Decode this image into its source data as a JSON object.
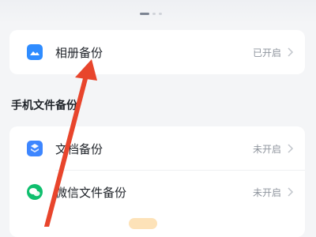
{
  "header": {
    "top_text": "",
    "page_indicator": {
      "count": 3,
      "active_index": 0
    }
  },
  "album_backup": {
    "icon": "album-icon",
    "label": "相册备份",
    "status": "已开启"
  },
  "phone_files_section": {
    "title": "手机文件备份",
    "items": [
      {
        "icon": "document-icon",
        "label": "文档备份",
        "status": "未开启"
      },
      {
        "icon": "wechat-icon",
        "label": "微信文件备份",
        "status": "未开启"
      }
    ]
  },
  "colors": {
    "background": "#f4f5f7",
    "card": "#ffffff",
    "annotation_arrow": "#e8452c",
    "status_text": "#8f959e",
    "album_icon": "#2f8cff",
    "wechat_icon": "#0fbf6e"
  }
}
